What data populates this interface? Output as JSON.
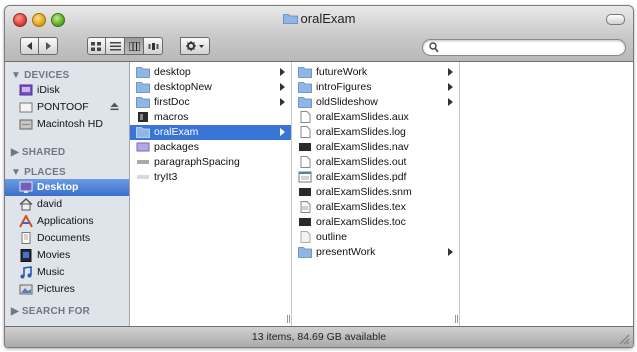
{
  "window": {
    "title": "oralExam",
    "status": "13 items, 84.69 GB available"
  },
  "toolbar": {
    "search_placeholder": ""
  },
  "sidebar": {
    "devices_heading": "▼ DEVICES",
    "shared_heading": "▶ SHARED",
    "places_heading": "▼ PLACES",
    "search_heading": "▶ SEARCH FOR",
    "devices": [
      {
        "label": "iDisk",
        "icon": "idisk-icon"
      },
      {
        "label": "PONTOOF",
        "icon": "drive-icon"
      },
      {
        "label": "Macintosh HD",
        "icon": "harddisk-icon"
      }
    ],
    "places": [
      {
        "label": "Desktop",
        "icon": "desktop-icon"
      },
      {
        "label": "david",
        "icon": "home-icon"
      },
      {
        "label": "Applications",
        "icon": "applications-icon"
      },
      {
        "label": "Documents",
        "icon": "documents-icon"
      },
      {
        "label": "Movies",
        "icon": "movies-icon"
      },
      {
        "label": "Music",
        "icon": "music-icon"
      },
      {
        "label": "Pictures",
        "icon": "pictures-icon"
      }
    ]
  },
  "column1": [
    {
      "label": "desktop",
      "icon": "folder-icon"
    },
    {
      "label": "desktopNew",
      "icon": "folder-icon"
    },
    {
      "label": "firstDoc",
      "icon": "folder-icon"
    },
    {
      "label": "macros",
      "icon": "file-black-icon"
    },
    {
      "label": "oralExam",
      "icon": "folder-icon"
    },
    {
      "label": "packages",
      "icon": "package-icon"
    },
    {
      "label": "paragraphSpacing",
      "icon": "file-gray-icon"
    },
    {
      "label": "tryIt3",
      "icon": "file-light-icon"
    }
  ],
  "column2": [
    {
      "label": "futureWork",
      "icon": "folder-icon"
    },
    {
      "label": "introFigures",
      "icon": "folder-icon"
    },
    {
      "label": "oldSlideshow",
      "icon": "folder-icon"
    },
    {
      "label": "oralExamSlides.aux",
      "icon": "document-icon"
    },
    {
      "label": "oralExamSlides.log",
      "icon": "document-icon"
    },
    {
      "label": "oralExamSlides.nav",
      "icon": "file-black-icon"
    },
    {
      "label": "oralExamSlides.out",
      "icon": "document-icon"
    },
    {
      "label": "oralExamSlides.pdf",
      "icon": "pdf-icon"
    },
    {
      "label": "oralExamSlides.snm",
      "icon": "file-black-icon"
    },
    {
      "label": "oralExamSlides.tex",
      "icon": "tex-icon"
    },
    {
      "label": "oralExamSlides.toc",
      "icon": "file-black-icon"
    },
    {
      "label": "outline",
      "icon": "document-icon"
    },
    {
      "label": "presentWork",
      "icon": "folder-icon"
    }
  ],
  "colors": {
    "selection": "#3875d7",
    "sidebar_bg": "#dee4ea",
    "sidebar_selection": "#4a7fd6",
    "folder": "#7fa9dd"
  }
}
